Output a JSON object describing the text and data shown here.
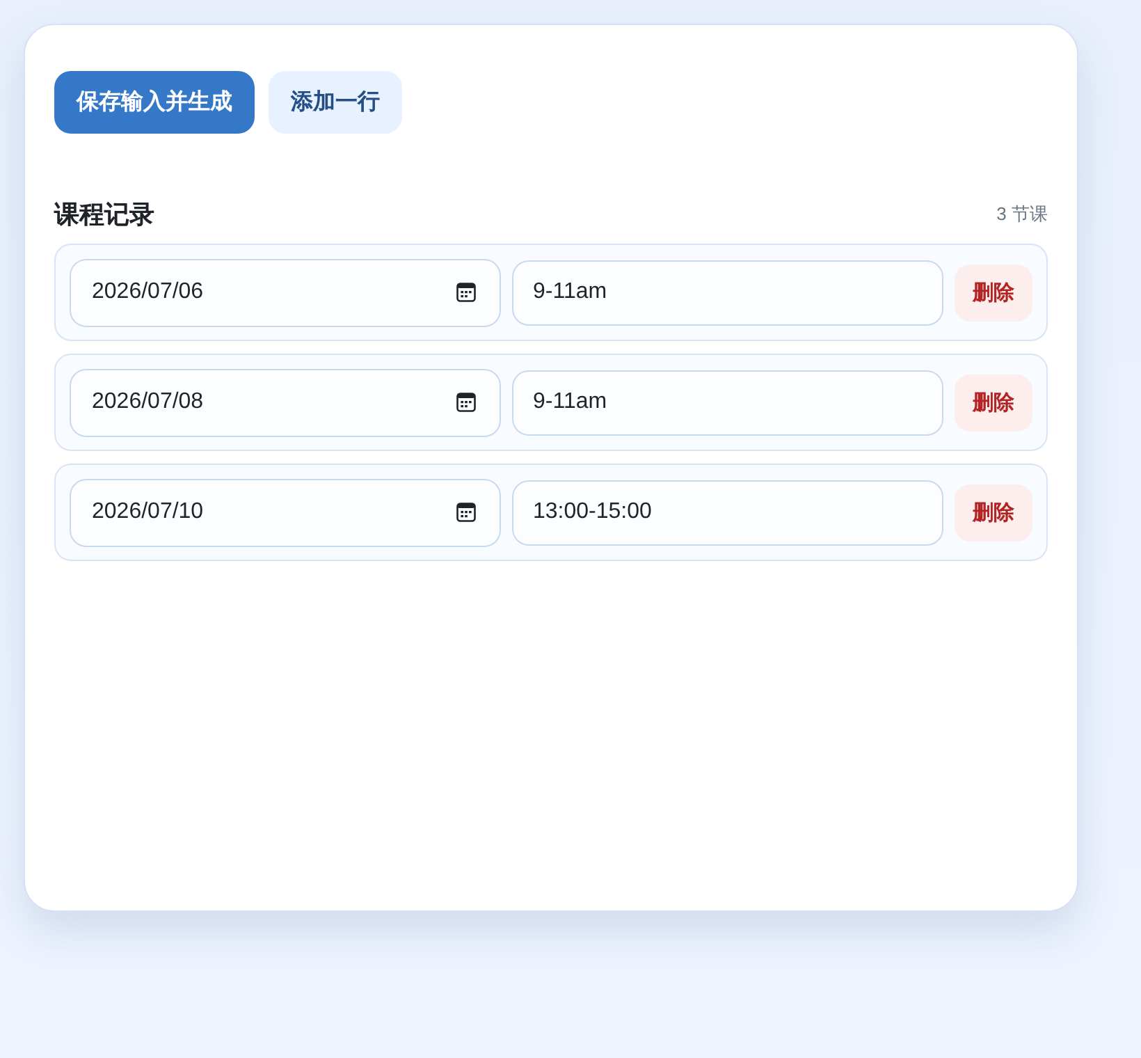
{
  "toolbar": {
    "buttons": [
      {
        "label": "保存输入并生成",
        "kind": "primary"
      },
      {
        "label": "添加一行",
        "kind": "secondary"
      }
    ]
  },
  "section": {
    "title": "课程记录",
    "count": "3 节课"
  },
  "rows": [
    {
      "date": "2026/07/06",
      "time": "9-11am",
      "delete_label": "删除"
    },
    {
      "date": "2026/07/08",
      "time": "9-11am",
      "delete_label": "删除"
    },
    {
      "date": "2026/07/10",
      "time": "13:00-15:00",
      "delete_label": "删除"
    }
  ]
}
